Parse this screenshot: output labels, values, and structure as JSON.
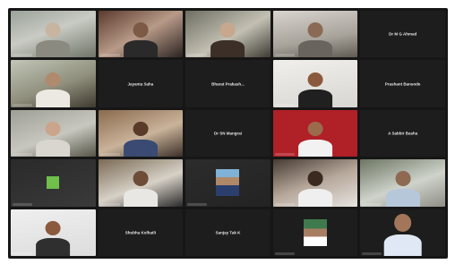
{
  "meeting": {
    "tiles": [
      {
        "type": "video"
      },
      {
        "type": "video"
      },
      {
        "type": "video"
      },
      {
        "type": "video"
      },
      {
        "type": "name",
        "label": "Dr M G Ahmad"
      },
      {
        "type": "video"
      },
      {
        "type": "name",
        "label": "Jayanta Saha"
      },
      {
        "type": "name",
        "label": "Bharat Prakash..."
      },
      {
        "type": "video"
      },
      {
        "type": "name",
        "label": "Prashant Bansode"
      },
      {
        "type": "video"
      },
      {
        "type": "video"
      },
      {
        "type": "name",
        "label": "Dr SN Mangrai"
      },
      {
        "type": "video"
      },
      {
        "type": "name",
        "label": "A Sabbir Basha"
      },
      {
        "type": "logo"
      },
      {
        "type": "video"
      },
      {
        "type": "photo"
      },
      {
        "type": "video"
      },
      {
        "type": "video"
      },
      {
        "type": "video"
      },
      {
        "type": "name",
        "label": "Shubha Kolhatli"
      },
      {
        "type": "name",
        "label": "Sanjay Tak K"
      },
      {
        "type": "photo"
      },
      {
        "type": "video"
      }
    ]
  }
}
